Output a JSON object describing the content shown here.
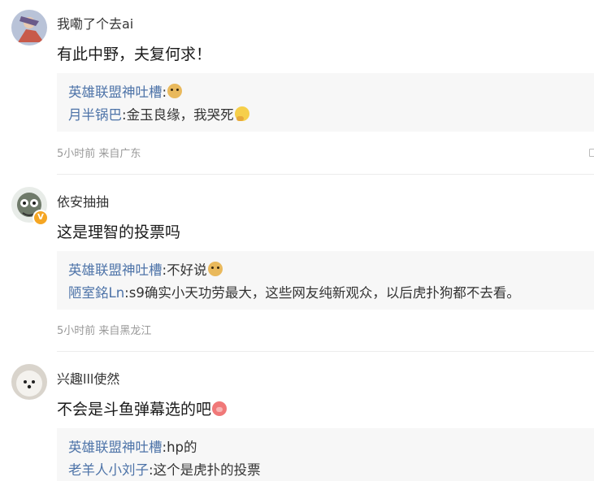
{
  "comments": [
    {
      "username": "我嘞了个去ai",
      "content": "有此中野，夫复何求！",
      "content_emoji": "",
      "replies": [
        {
          "user": "英雄联盟神吐槽",
          "text": "",
          "emoji": "doge-emoji"
        },
        {
          "user": "月半锅巴",
          "text": "金玉良缘，我哭死",
          "emoji": "thinking-emoji"
        }
      ],
      "meta": "5小时前 来自广东",
      "verified": false
    },
    {
      "username": "依安抽抽",
      "content": "这是理智的投票吗",
      "content_emoji": "",
      "replies": [
        {
          "user": "英雄联盟神吐槽",
          "text": "不好说",
          "emoji": "doge-emoji"
        },
        {
          "user": "陋室銘Ln",
          "text": "s9确实小天功劳最大，这些网友纯新观众，以后虎扑狗都不去看。",
          "emoji": ""
        }
      ],
      "meta": "5小时前 来自黑龙江",
      "verified": true
    },
    {
      "username": "兴趣lll使然",
      "content": "不会是斗鱼弹幕选的吧",
      "content_emoji": "pig-emoji",
      "replies": [
        {
          "user": "英雄联盟神吐槽",
          "text": "hp的",
          "emoji": ""
        },
        {
          "user": "老羊人小刘子",
          "text": "这个是虎扑的投票",
          "emoji": ""
        }
      ],
      "meta": "",
      "verified": false
    }
  ],
  "verified_badge": "V",
  "reply_separator": ":",
  "colors": {
    "reply_user": "#4d73a8",
    "reply_bg": "#f7f7f7",
    "meta": "#999999"
  }
}
